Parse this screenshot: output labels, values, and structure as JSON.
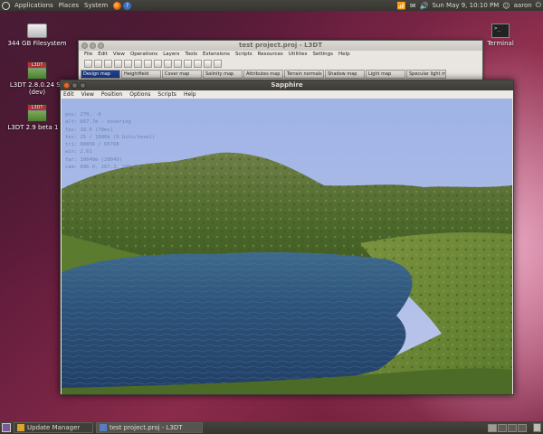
{
  "top_panel": {
    "menus": [
      "Applications",
      "Places",
      "System"
    ],
    "clock": "Sun May  9, 10:10 PM",
    "user": "aaron",
    "icons": [
      "ubuntu-logo-icon",
      "firefox-icon",
      "help-icon",
      "network-icon",
      "mail-icon",
      "volume-icon",
      "power-icon"
    ]
  },
  "desktop": {
    "icons": [
      {
        "label": "344 GB Filesystem",
        "icon": "harddisk-icon"
      },
      {
        "label": "L3DT 2.8.0.24 SE (dev)",
        "icon": "l3dt-icon"
      },
      {
        "label": "L3DT 2.9 beta 1 Pr",
        "icon": "l3dt-icon"
      },
      {
        "label": "Terminal",
        "icon": "terminal-icon"
      }
    ]
  },
  "l3dt_window": {
    "title": "test project.proj - L3DT",
    "menu": [
      "File",
      "Edit",
      "View",
      "Operations",
      "Layers",
      "Tools",
      "Extensions",
      "Scripts",
      "Resources",
      "Utilities",
      "Settings",
      "Help"
    ],
    "tabs": [
      "Design map",
      "Heightfield",
      "Cover map",
      "Salinity map",
      "Attributes map",
      "Terrain normals",
      "Shadow map",
      "Light map",
      "Specular light map"
    ],
    "active_tab": "Design map"
  },
  "sapphire_window": {
    "title": "Sapphire",
    "menu": [
      "Edit",
      "View",
      "Position",
      "Options",
      "Scripts",
      "Help"
    ],
    "hud": [
      "pos: 270, -9",
      "alt: 667.7m - hovering",
      "fps: 18.6 (78ms)",
      "tex: 25 / 1080k (9 bits/texel)",
      "tri: 60856 / 65768",
      "win: 2.61",
      "far: 10049m (20049)",
      "cam: 896.0, 267.3, 249.7m"
    ]
  },
  "bottom_panel": {
    "tasks": [
      {
        "label": "Update Manager",
        "active": false
      },
      {
        "label": "test project.proj - L3DT",
        "active": true
      }
    ]
  },
  "colors": {
    "panel": "#3c3b37",
    "wallpaper": "#6a1f3f",
    "accent_close": "#e06a2a",
    "sky": "#aeb9e4",
    "water": "#2c4f7a",
    "grass": "#5f7d34"
  }
}
